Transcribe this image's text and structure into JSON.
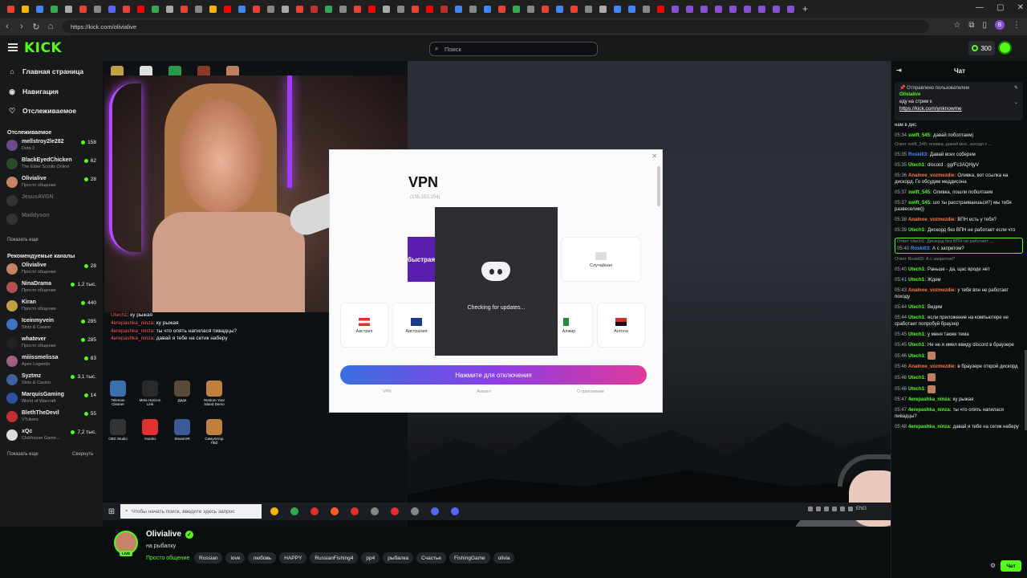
{
  "browser": {
    "url": "https://kick.com/olivialive",
    "tab_colors": [
      "#e94235",
      "#f4b400",
      "#4285f4",
      "#34a853",
      "#aaaaaa",
      "#e94235",
      "#888888",
      "#5865f2",
      "#e94235",
      "#ff0000",
      "#34a853",
      "#aaaaaa",
      "#e94235",
      "#888888",
      "#f4b400",
      "#ff0000",
      "#4285f4",
      "#e94235",
      "#888888",
      "#aaaaaa",
      "#e94235",
      "#c03030",
      "#34a853",
      "#888888",
      "#e94235",
      "#ff0000",
      "#aaaaaa",
      "#888888",
      "#e94235",
      "#ff0000",
      "#c03030",
      "#4285f4",
      "#888888",
      "#4285f4",
      "#e94235",
      "#34a853",
      "#888888",
      "#e94235",
      "#4285f4",
      "#e94235",
      "#888888",
      "#aaaaaa",
      "#4285f4",
      "#4285f4",
      "#888888",
      "#ff0000",
      "#8a4fd6",
      "#8a4fd6",
      "#8a4fd6",
      "#8a4fd6",
      "#8a4fd6",
      "#8a4fd6",
      "#8a4fd6",
      "#8a4fd6",
      "#8a4fd6"
    ],
    "new_tab": "+",
    "profile_initial": "B"
  },
  "header": {
    "logo": "KICK",
    "search_placeholder": "Поиск",
    "points": "300"
  },
  "sidebar": {
    "nav": [
      {
        "label": "Главная страница",
        "icon": "home-icon"
      },
      {
        "label": "Навигация",
        "icon": "compass-icon"
      },
      {
        "label": "Отслеживаемое",
        "icon": "heart-icon"
      }
    ],
    "following_title": "Отслеживаемое",
    "following": [
      {
        "name": "mellstroy2le282",
        "game": "Dota 2",
        "viewers": "158",
        "color": "#6a4a8a"
      },
      {
        "name": "BlackEyedChicken",
        "game": "The Elder Scrolls Online",
        "viewers": "62",
        "color": "#2a4a2a"
      },
      {
        "name": "Olivialive",
        "game": "Просто общение",
        "viewers": "28",
        "color": "#c58465"
      },
      {
        "name": "JesusAVGN",
        "game": "",
        "viewers": "",
        "color": "#333333"
      },
      {
        "name": "Maddyson",
        "game": "",
        "viewers": "",
        "color": "#333333"
      }
    ],
    "show_more": "Показать еще",
    "recommended_title": "Рекомендуемые каналы",
    "recommended": [
      {
        "name": "Olivialive",
        "game": "Просто общение",
        "viewers": "28",
        "color": "#c58465"
      },
      {
        "name": "NinaDrama",
        "game": "Просто общение",
        "viewers": "1,2 тыс.",
        "color": "#b05050"
      },
      {
        "name": "Kiran",
        "game": "Просто общение",
        "viewers": "440",
        "color": "#c0a040"
      },
      {
        "name": "Iceinmyvein",
        "game": "Slots & Casino",
        "viewers": "285",
        "color": "#4070c0"
      },
      {
        "name": "whatever",
        "game": "Просто общение",
        "viewers": "285",
        "color": "#222222"
      },
      {
        "name": "miiissmelissa",
        "game": "Apex Legends",
        "viewers": "83",
        "color": "#a06080"
      },
      {
        "name": "Syztmz",
        "game": "Slots & Casino",
        "viewers": "3,1 тыс.",
        "color": "#4060a0"
      },
      {
        "name": "MarquisGaming",
        "game": "World of Warcraft",
        "viewers": "14",
        "color": "#3050a0"
      },
      {
        "name": "BlethTheDevil",
        "game": "VTubers",
        "viewers": "55",
        "color": "#c03030"
      },
      {
        "name": "xQc",
        "game": "Clubhouse Game...",
        "viewers": "7,2 тыс.",
        "color": "#dddddd"
      }
    ],
    "show_more2": "Показать еще",
    "collapse": "Свернуть"
  },
  "stream": {
    "overlay_lines": [
      {
        "nick": "Utech1",
        "text": ": ку рыжая"
      },
      {
        "nick": "4erepashka_ninza",
        "text": ": ку рыжая"
      },
      {
        "nick": "4erepashka_ninza",
        "text": ": ты что опять напилася пивадцы?"
      },
      {
        "nick": "4erepashka_ninza",
        "text": ": давай я тебе на сетик наберу"
      }
    ],
    "desktop_icons": [
      {
        "label": "Telemon Cleaner",
        "color": "#3a6fb0"
      },
      {
        "label": "Meta Horizon Link",
        "color": "#2a2a2a"
      },
      {
        "label": "Дида",
        "color": "#5a4a3a"
      },
      {
        "label": "Restore Your Island Demo",
        "color": "#c08040"
      }
    ],
    "desktop_icons2": [
      {
        "label": "OBS Studio",
        "color": "#333333"
      },
      {
        "label": "Yandex",
        "color": "#e03030"
      },
      {
        "label": "SteamVR",
        "color": "#3a5a9a"
      },
      {
        "label": "Симулятор ПВЗ",
        "color": "#c08040"
      }
    ],
    "vpn": {
      "title": "VPN",
      "ip": "(135.152.204)",
      "fast": "быстрая",
      "random": "Случайная",
      "countries": [
        "Австрия",
        "Австралия",
        "Алжир",
        "Ангола"
      ],
      "button": "Нажмите для отключения",
      "bottom": [
        "VPN",
        "Аккаунт",
        "О приложении"
      ]
    },
    "discord": {
      "status": "Checking for updates..."
    },
    "taskbar_search": "Чтобы начать поиск, введите здесь запрос",
    "taskbar_apps": [
      "#f4b400",
      "#34a853",
      "#e03030",
      "#ff5b2b",
      "#e03030",
      "#888888",
      "#e03030",
      "#888888",
      "#5865f2",
      "#5865f2"
    ],
    "tray_lang": "ENG"
  },
  "channel": {
    "name": "Olivialive",
    "title": "на рыбалку",
    "category": "Просто общение",
    "live_badge": "LIVE",
    "tags": [
      "Russian",
      "love",
      "любовь",
      "HAPPY",
      "RussianFishing4",
      "pp4",
      "рыбалка",
      "Счастье",
      "FishingGame",
      "olivia"
    ]
  },
  "chat": {
    "title": "Чат",
    "pinned_by": "Отправлено пользователем",
    "pinned_user": "Olivialive",
    "pinned_text": "еду на стрим к",
    "pinned_link": "https://kick.com/ynknowme",
    "messages": [
      {
        "time": "",
        "user": "",
        "ucolor": "#eeeeee",
        "text": "нам в дис",
        "reply": ""
      },
      {
        "time": "05:34",
        "user": "swift_545:",
        "ucolor": "#53fc18",
        "text": "давай побоптаем)",
        "reply": ""
      },
      {
        "time": "",
        "user": "",
        "ucolor": "#eeeeee",
        "text": "",
        "reply": "Ответ swift_545: оливка, давай мне, заходи к ..."
      },
      {
        "time": "05:35",
        "user": "Roskill3:",
        "ucolor": "#4a8dff",
        "text": "Давай всех соберем",
        "reply": ""
      },
      {
        "time": "05:35",
        "user": "Utech1:",
        "ucolor": "#53fc18",
        "text": "discord . gg/Fc3AQHjyV",
        "reply": ""
      },
      {
        "time": "05:36",
        "user": "Analnoe_vozmezdie:",
        "ucolor": "#ff7a3a",
        "text": "Оливка, вот ссылка на дискорд. Го обсудим меддисона",
        "reply": ""
      },
      {
        "time": "05:37",
        "user": "swift_545:",
        "ucolor": "#53fc18",
        "text": "Оливка, пошли поболтаем",
        "reply": ""
      },
      {
        "time": "05:37",
        "user": "swift_545:",
        "ucolor": "#53fc18",
        "text": "шо ты расстраиваешься?) мы тебя развеселим))",
        "reply": ""
      },
      {
        "time": "05:38",
        "user": "Analnoe_vozmezdie:",
        "ucolor": "#ff7a3a",
        "text": "ВПН есть у тебя?",
        "reply": ""
      },
      {
        "time": "05:39",
        "user": "Utech1:",
        "ucolor": "#53fc18",
        "text": "Дискорд без ВПН не работает если что",
        "reply": ""
      },
      {
        "time": "05:40",
        "user": "Roskill3:",
        "ucolor": "#4a8dff",
        "text": "А с запретом?",
        "reply": "Ответ Utech1: Дискорд без ВПН не работает ...",
        "hl": true
      },
      {
        "time": "",
        "user": "",
        "ucolor": "#eeeeee",
        "text": "",
        "reply": "Ответ Roskill3: А с запретом?"
      },
      {
        "time": "05:40",
        "user": "Utech1:",
        "ucolor": "#53fc18",
        "text": "Раньше - да, щас вроде нет",
        "reply": ""
      },
      {
        "time": "05:41",
        "user": "Utech1:",
        "ucolor": "#53fc18",
        "text": "Ждем",
        "reply": ""
      },
      {
        "time": "05:43",
        "user": "Analnoe_vozmezdie:",
        "ucolor": "#ff7a3a",
        "text": "у тебя впн не работает походу",
        "reply": ""
      },
      {
        "time": "05:44",
        "user": "Utech1:",
        "ucolor": "#53fc18",
        "text": "Видим",
        "reply": ""
      },
      {
        "time": "05:44",
        "user": "Utech1:",
        "ucolor": "#53fc18",
        "text": "если приложение на компьютере не сработает попробуй браузер",
        "reply": ""
      },
      {
        "time": "05:45",
        "user": "Utech1:",
        "ucolor": "#53fc18",
        "text": "у меня также тема",
        "reply": ""
      },
      {
        "time": "05:45",
        "user": "Utech1:",
        "ucolor": "#53fc18",
        "text": "Не не я имел ввиду discord в браузере",
        "reply": ""
      },
      {
        "time": "05:46",
        "user": "Utech1:",
        "ucolor": "#53fc18",
        "text": "",
        "reply": ""
      },
      {
        "time": "05:46",
        "user": "Analnoe_vozmezdie:",
        "ucolor": "#ff7a3a",
        "text": "в браузере открой дискорд",
        "reply": ""
      },
      {
        "time": "05:46",
        "user": "Utech1:",
        "ucolor": "#53fc18",
        "text": "",
        "reply": ""
      },
      {
        "time": "05:46",
        "user": "Utech1:",
        "ucolor": "#53fc18",
        "text": "",
        "reply": ""
      },
      {
        "time": "05:47",
        "user": "4erepashka_ninza:",
        "ucolor": "#53fc18",
        "text": "ку рыжая",
        "reply": ""
      },
      {
        "time": "05:47",
        "user": "4erepashka_ninza:",
        "ucolor": "#53fc18",
        "text": "ты что опять напилася пивадцы?",
        "reply": ""
      },
      {
        "time": "05:48",
        "user": "4erepashka_ninza:",
        "ucolor": "#53fc18",
        "text": "давай я тебе на сетик наберу",
        "reply": ""
      }
    ],
    "send": "Чат"
  }
}
